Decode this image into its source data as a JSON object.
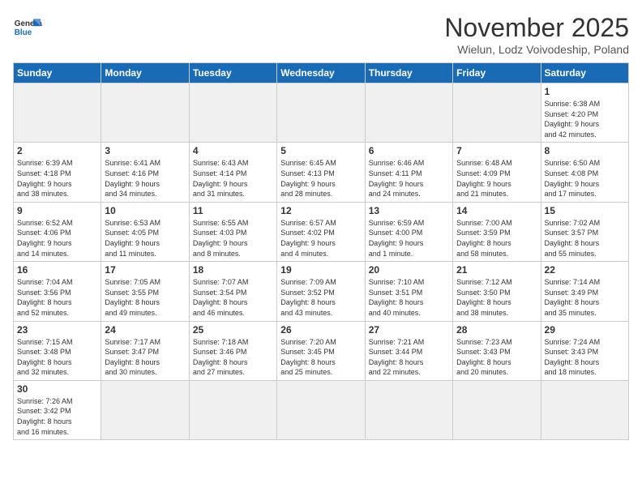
{
  "header": {
    "logo_line1": "General",
    "logo_line2": "Blue",
    "title": "November 2025",
    "subtitle": "Wielun, Lodz Voivodeship, Poland"
  },
  "weekdays": [
    "Sunday",
    "Monday",
    "Tuesday",
    "Wednesday",
    "Thursday",
    "Friday",
    "Saturday"
  ],
  "weeks": [
    [
      {
        "day": "",
        "info": "",
        "empty": true
      },
      {
        "day": "",
        "info": "",
        "empty": true
      },
      {
        "day": "",
        "info": "",
        "empty": true
      },
      {
        "day": "",
        "info": "",
        "empty": true
      },
      {
        "day": "",
        "info": "",
        "empty": true
      },
      {
        "day": "",
        "info": "",
        "empty": true
      },
      {
        "day": "1",
        "info": "Sunrise: 6:38 AM\nSunset: 4:20 PM\nDaylight: 9 hours\nand 42 minutes."
      }
    ],
    [
      {
        "day": "2",
        "info": "Sunrise: 6:39 AM\nSunset: 4:18 PM\nDaylight: 9 hours\nand 38 minutes."
      },
      {
        "day": "3",
        "info": "Sunrise: 6:41 AM\nSunset: 4:16 PM\nDaylight: 9 hours\nand 34 minutes."
      },
      {
        "day": "4",
        "info": "Sunrise: 6:43 AM\nSunset: 4:14 PM\nDaylight: 9 hours\nand 31 minutes."
      },
      {
        "day": "5",
        "info": "Sunrise: 6:45 AM\nSunset: 4:13 PM\nDaylight: 9 hours\nand 28 minutes."
      },
      {
        "day": "6",
        "info": "Sunrise: 6:46 AM\nSunset: 4:11 PM\nDaylight: 9 hours\nand 24 minutes."
      },
      {
        "day": "7",
        "info": "Sunrise: 6:48 AM\nSunset: 4:09 PM\nDaylight: 9 hours\nand 21 minutes."
      },
      {
        "day": "8",
        "info": "Sunrise: 6:50 AM\nSunset: 4:08 PM\nDaylight: 9 hours\nand 17 minutes."
      }
    ],
    [
      {
        "day": "9",
        "info": "Sunrise: 6:52 AM\nSunset: 4:06 PM\nDaylight: 9 hours\nand 14 minutes."
      },
      {
        "day": "10",
        "info": "Sunrise: 6:53 AM\nSunset: 4:05 PM\nDaylight: 9 hours\nand 11 minutes."
      },
      {
        "day": "11",
        "info": "Sunrise: 6:55 AM\nSunset: 4:03 PM\nDaylight: 9 hours\nand 8 minutes."
      },
      {
        "day": "12",
        "info": "Sunrise: 6:57 AM\nSunset: 4:02 PM\nDaylight: 9 hours\nand 4 minutes."
      },
      {
        "day": "13",
        "info": "Sunrise: 6:59 AM\nSunset: 4:00 PM\nDaylight: 9 hours\nand 1 minute."
      },
      {
        "day": "14",
        "info": "Sunrise: 7:00 AM\nSunset: 3:59 PM\nDaylight: 8 hours\nand 58 minutes."
      },
      {
        "day": "15",
        "info": "Sunrise: 7:02 AM\nSunset: 3:57 PM\nDaylight: 8 hours\nand 55 minutes."
      }
    ],
    [
      {
        "day": "16",
        "info": "Sunrise: 7:04 AM\nSunset: 3:56 PM\nDaylight: 8 hours\nand 52 minutes."
      },
      {
        "day": "17",
        "info": "Sunrise: 7:05 AM\nSunset: 3:55 PM\nDaylight: 8 hours\nand 49 minutes."
      },
      {
        "day": "18",
        "info": "Sunrise: 7:07 AM\nSunset: 3:54 PM\nDaylight: 8 hours\nand 46 minutes."
      },
      {
        "day": "19",
        "info": "Sunrise: 7:09 AM\nSunset: 3:52 PM\nDaylight: 8 hours\nand 43 minutes."
      },
      {
        "day": "20",
        "info": "Sunrise: 7:10 AM\nSunset: 3:51 PM\nDaylight: 8 hours\nand 40 minutes."
      },
      {
        "day": "21",
        "info": "Sunrise: 7:12 AM\nSunset: 3:50 PM\nDaylight: 8 hours\nand 38 minutes."
      },
      {
        "day": "22",
        "info": "Sunrise: 7:14 AM\nSunset: 3:49 PM\nDaylight: 8 hours\nand 35 minutes."
      }
    ],
    [
      {
        "day": "23",
        "info": "Sunrise: 7:15 AM\nSunset: 3:48 PM\nDaylight: 8 hours\nand 32 minutes."
      },
      {
        "day": "24",
        "info": "Sunrise: 7:17 AM\nSunset: 3:47 PM\nDaylight: 8 hours\nand 30 minutes."
      },
      {
        "day": "25",
        "info": "Sunrise: 7:18 AM\nSunset: 3:46 PM\nDaylight: 8 hours\nand 27 minutes."
      },
      {
        "day": "26",
        "info": "Sunrise: 7:20 AM\nSunset: 3:45 PM\nDaylight: 8 hours\nand 25 minutes."
      },
      {
        "day": "27",
        "info": "Sunrise: 7:21 AM\nSunset: 3:44 PM\nDaylight: 8 hours\nand 22 minutes."
      },
      {
        "day": "28",
        "info": "Sunrise: 7:23 AM\nSunset: 3:43 PM\nDaylight: 8 hours\nand 20 minutes."
      },
      {
        "day": "29",
        "info": "Sunrise: 7:24 AM\nSunset: 3:43 PM\nDaylight: 8 hours\nand 18 minutes."
      }
    ],
    [
      {
        "day": "30",
        "info": "Sunrise: 7:26 AM\nSunset: 3:42 PM\nDaylight: 8 hours\nand 16 minutes."
      },
      {
        "day": "",
        "info": "",
        "empty": true
      },
      {
        "day": "",
        "info": "",
        "empty": true
      },
      {
        "day": "",
        "info": "",
        "empty": true
      },
      {
        "day": "",
        "info": "",
        "empty": true
      },
      {
        "day": "",
        "info": "",
        "empty": true
      },
      {
        "day": "",
        "info": "",
        "empty": true
      }
    ]
  ]
}
